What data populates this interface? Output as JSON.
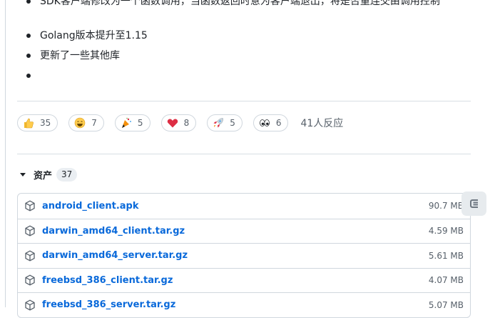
{
  "notes": {
    "items": [
      "SDK客户端修改为一个函数调用，当函数返回时意为客户端退出，将是否重连交由调用控制",
      "Golang版本提升至1.15",
      "更新了一些其他库",
      ""
    ]
  },
  "reactions": {
    "items": [
      {
        "icon": "thumbs-up-icon",
        "count": "35"
      },
      {
        "icon": "laugh-icon",
        "count": "7"
      },
      {
        "icon": "hooray-icon",
        "count": "5"
      },
      {
        "icon": "heart-icon",
        "count": "8"
      },
      {
        "icon": "rocket-icon",
        "count": "5"
      },
      {
        "icon": "eyes-icon",
        "count": "6"
      }
    ],
    "summary": "41人反应"
  },
  "assets": {
    "title": "资产",
    "count": "37",
    "files": [
      {
        "name": "android_client.apk",
        "size": "90.7 MB"
      },
      {
        "name": "darwin_amd64_client.tar.gz",
        "size": "4.59 MB"
      },
      {
        "name": "darwin_amd64_server.tar.gz",
        "size": "5.61 MB"
      },
      {
        "name": "freebsd_386_client.tar.gz",
        "size": "4.07 MB"
      },
      {
        "name": "freebsd_386_server.tar.gz",
        "size": "5.07 MB"
      }
    ]
  },
  "colors": {
    "link": "#0969da",
    "border": "#d0d7de",
    "muted": "#57606a"
  }
}
